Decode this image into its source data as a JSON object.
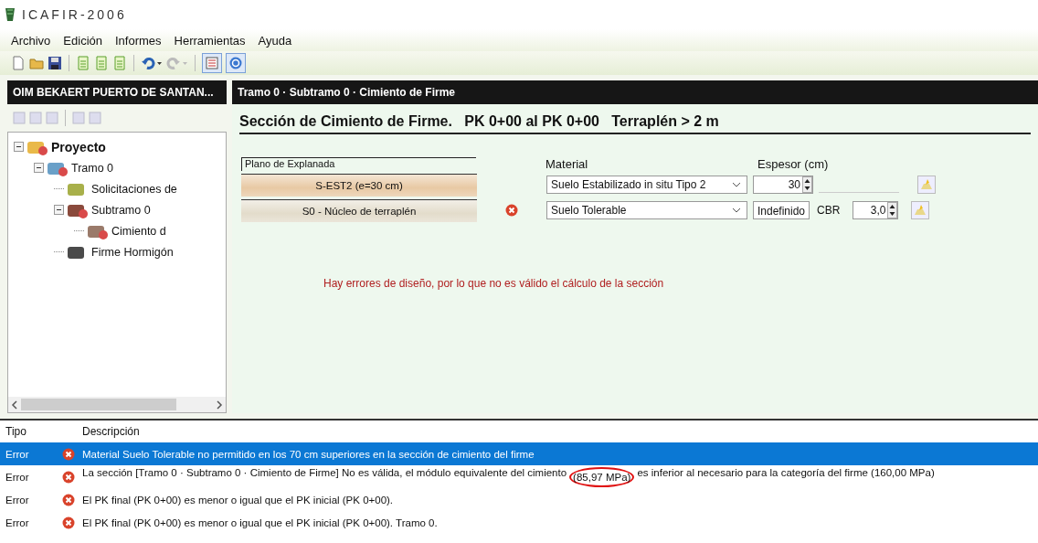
{
  "window": {
    "title": "ICAFIR-2006"
  },
  "menu": [
    "Archivo",
    "Edición",
    "Informes",
    "Herramientas",
    "Ayuda"
  ],
  "project_header": "OIM BEKAERT PUERTO DE SANTAN...",
  "tree": [
    {
      "label": "Proyecto",
      "kind": "project",
      "error": true,
      "expanded": true,
      "bold": true,
      "children": [
        {
          "label": "Tramo 0",
          "kind": "section",
          "error": true,
          "expanded": true,
          "bold": false,
          "children": [
            {
              "label": "Solicitaciones de",
              "kind": "traffic",
              "error": false,
              "bold": false
            },
            {
              "label": "Subtramo 0",
              "kind": "subsection",
              "error": true,
              "expanded": true,
              "bold": false,
              "children": [
                {
                  "label": "Cimiento d",
                  "kind": "foundation",
                  "error": true,
                  "bold": false
                }
              ]
            },
            {
              "label": "Firme Hormigón",
              "kind": "pavement",
              "error": false,
              "bold": false
            }
          ]
        }
      ]
    }
  ],
  "breadcrumb": "Tramo 0 · Subtramo 0 · Cimiento de Firme",
  "heading": "Sección de Cimiento de Firme.   PK 0+00 al PK 0+00   Terraplén > 2 m",
  "layers": {
    "group_label": "Plano de Explanada",
    "material_label": "Material",
    "thickness_label": "Espesor (cm)",
    "rows": [
      {
        "kind": "thickness",
        "name": "S-EST2 (e=30 cm)",
        "color": "#e8c9a4",
        "error": false,
        "material": "Suelo Estabilizado in situ Tipo 2",
        "thickness": "30"
      },
      {
        "kind": "cbr",
        "name": "S0 - Núcleo de terraplén",
        "color": "#e3dccb",
        "error": true,
        "material": "Suelo Tolerable",
        "thickness": "Indefinido",
        "cbr_label": "CBR",
        "cbr": "3,0"
      }
    ]
  },
  "design_error": "Hay errores de diseño, por lo que no es válido el cálculo de la sección",
  "messages": {
    "columns": [
      "Tipo",
      "Descripción"
    ],
    "rows": [
      {
        "selected": true,
        "type": "Error",
        "description": [
          {
            "text": "Material Suelo Tolerable no permitido en los 70 cm superiores en la sección de cimiento del firme",
            "circled": false
          }
        ]
      },
      {
        "selected": false,
        "type": "Error",
        "description": [
          {
            "text": "La sección [Tramo 0 · Subtramo 0 · Cimiento de Firme] No es válida, el módulo equivalente del cimiento",
            "circled": false
          },
          {
            "text": "(85,97 MPa)",
            "circled": true
          },
          {
            "text": "es inferior al necesario para la categoría del firme (160,00 MPa)",
            "circled": false
          }
        ]
      },
      {
        "selected": false,
        "type": "Error",
        "description": [
          {
            "text": "El PK final (PK 0+00) es menor o igual que el PK inicial (PK 0+00).",
            "circled": false
          }
        ]
      },
      {
        "selected": false,
        "type": "Error",
        "description": [
          {
            "text": "El PK final (PK 0+00) es menor o igual que el PK inicial (PK 0+00). Tramo 0.",
            "circled": false
          }
        ]
      }
    ]
  }
}
